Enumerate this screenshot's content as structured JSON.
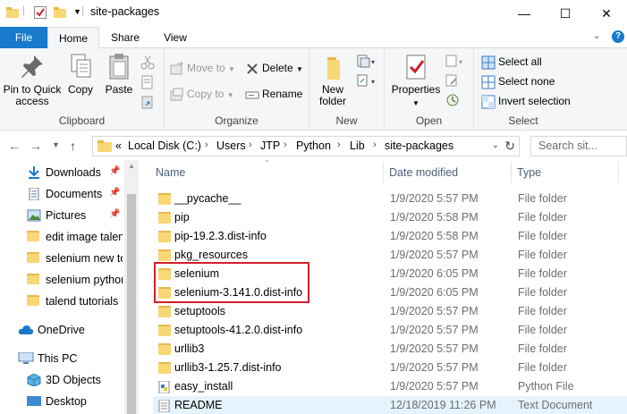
{
  "window": {
    "title": "site-packages",
    "controls": {
      "minimize": "—",
      "maximize": "☐",
      "close": "✕"
    }
  },
  "ribbon_tabs": [
    "File",
    "Home",
    "Share",
    "View"
  ],
  "ribbon": {
    "clipboard": {
      "label": "Clipboard",
      "pin": "Pin to Quick access",
      "copy": "Copy",
      "paste": "Paste",
      "cut_icon": "scissors-icon",
      "copy_path_icon": "copy-path-icon",
      "paste_shortcut_icon": "paste-shortcut-icon"
    },
    "organize": {
      "label": "Organize",
      "move_to": "Move to",
      "copy_to": "Copy to",
      "delete": "Delete",
      "rename": "Rename"
    },
    "new": {
      "label": "New",
      "new_folder": "New folder"
    },
    "open": {
      "label": "Open",
      "properties": "Properties"
    },
    "select": {
      "label": "Select",
      "select_all": "Select all",
      "select_none": "Select none",
      "invert": "Invert selection"
    }
  },
  "address": {
    "overflow": "«",
    "crumbs": [
      "Local Disk (C:)",
      "Users",
      "JTP",
      "Python",
      "Lib",
      "site-packages"
    ],
    "search_placeholder": "Search sit..."
  },
  "nav_pane": [
    {
      "label": "Downloads",
      "icon": "download-arrow-icon",
      "pinned": true
    },
    {
      "label": "Documents",
      "icon": "documents-icon",
      "pinned": true
    },
    {
      "label": "Pictures",
      "icon": "pictures-icon",
      "pinned": true
    },
    {
      "label": "edit image talend",
      "icon": "folder-icon",
      "pinned": false
    },
    {
      "label": "selenium new to",
      "icon": "folder-icon",
      "pinned": false
    },
    {
      "label": "selenium python",
      "icon": "folder-icon",
      "pinned": false
    },
    {
      "label": "talend tutorials",
      "icon": "folder-icon",
      "pinned": false
    },
    {
      "label": "OneDrive",
      "icon": "cloud-icon",
      "pinned": false
    },
    {
      "label": "This PC",
      "icon": "computer-icon",
      "pinned": false
    },
    {
      "label": "3D Objects",
      "icon": "cube-icon",
      "pinned": false
    },
    {
      "label": "Desktop",
      "icon": "desktop-icon",
      "pinned": false
    }
  ],
  "columns": {
    "name": "Name",
    "date": "Date modified",
    "type": "Type"
  },
  "files": [
    {
      "name": "__pycache__",
      "date": "1/9/2020 5:57 PM",
      "type": "File folder",
      "icon": "folder-icon"
    },
    {
      "name": "pip",
      "date": "1/9/2020 5:58 PM",
      "type": "File folder",
      "icon": "folder-icon"
    },
    {
      "name": "pip-19.2.3.dist-info",
      "date": "1/9/2020 5:58 PM",
      "type": "File folder",
      "icon": "folder-icon"
    },
    {
      "name": "pkg_resources",
      "date": "1/9/2020 5:57 PM",
      "type": "File folder",
      "icon": "folder-icon"
    },
    {
      "name": "selenium",
      "date": "1/9/2020 6:05 PM",
      "type": "File folder",
      "icon": "folder-icon"
    },
    {
      "name": "selenium-3.141.0.dist-info",
      "date": "1/9/2020 6:05 PM",
      "type": "File folder",
      "icon": "folder-icon"
    },
    {
      "name": "setuptools",
      "date": "1/9/2020 5:57 PM",
      "type": "File folder",
      "icon": "folder-icon"
    },
    {
      "name": "setuptools-41.2.0.dist-info",
      "date": "1/9/2020 5:57 PM",
      "type": "File folder",
      "icon": "folder-icon"
    },
    {
      "name": "urllib3",
      "date": "1/9/2020 5:57 PM",
      "type": "File folder",
      "icon": "folder-icon"
    },
    {
      "name": "urllib3-1.25.7.dist-info",
      "date": "1/9/2020 5:57 PM",
      "type": "File folder",
      "icon": "folder-icon"
    },
    {
      "name": "easy_install",
      "date": "1/9/2020 5:57 PM",
      "type": "Python File",
      "icon": "python-file-icon"
    },
    {
      "name": "README",
      "date": "12/18/2019 11:26 PM",
      "type": "Text Document",
      "icon": "text-document-icon"
    }
  ],
  "colors": {
    "file_tab": "#1979ca",
    "highlight_box": "#d0202a",
    "selected_row": "#e5f3ff",
    "folder": "#f8d775"
  }
}
